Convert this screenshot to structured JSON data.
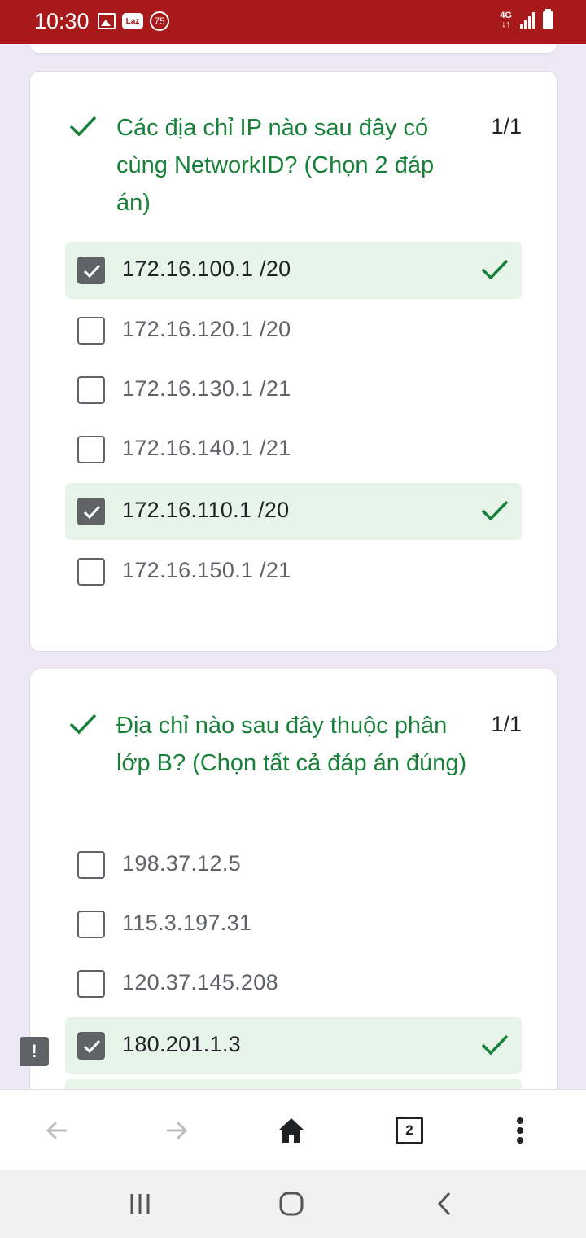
{
  "status_bar": {
    "time": "10:30",
    "laz_label": "Laz",
    "badge_count": "75",
    "network_label": "4G",
    "background_color": "#a8191b"
  },
  "questions": [
    {
      "text": "Các địa chỉ IP nào sau đây có cùng NetworkID? (Chọn 2 đáp án)",
      "score": "1/1",
      "options": [
        {
          "label": "172.16.100.1 /20",
          "checked": true,
          "correct": true
        },
        {
          "label": "172.16.120.1 /20",
          "checked": false,
          "correct": false
        },
        {
          "label": "172.16.130.1 /21",
          "checked": false,
          "correct": false
        },
        {
          "label": "172.16.140.1 /21",
          "checked": false,
          "correct": false
        },
        {
          "label": "172.16.110.1 /20",
          "checked": true,
          "correct": true
        },
        {
          "label": "172.16.150.1 /21",
          "checked": false,
          "correct": false
        }
      ]
    },
    {
      "text": "Địa chỉ nào sau đây thuộc phân lớp B? (Chọn tất cả đáp án đúng)",
      "score": "1/1",
      "options": [
        {
          "label": "198.37.12.5",
          "checked": false,
          "correct": false
        },
        {
          "label": "115.3.197.31",
          "checked": false,
          "correct": false
        },
        {
          "label": "120.37.145.208",
          "checked": false,
          "correct": false
        },
        {
          "label": "180.201.1.3",
          "checked": true,
          "correct": true
        }
      ]
    }
  ],
  "feedback_icon": "report-problem-icon",
  "toolbar": {
    "back_icon": "arrow-back-icon",
    "forward_icon": "arrow-forward-icon",
    "home_icon": "home-icon",
    "tab_count": "2",
    "menu_icon": "more-vert-icon"
  },
  "colors": {
    "correct_green": "#188038",
    "correct_bg": "#e6f4ea",
    "form_bg": "#ede7f6"
  }
}
